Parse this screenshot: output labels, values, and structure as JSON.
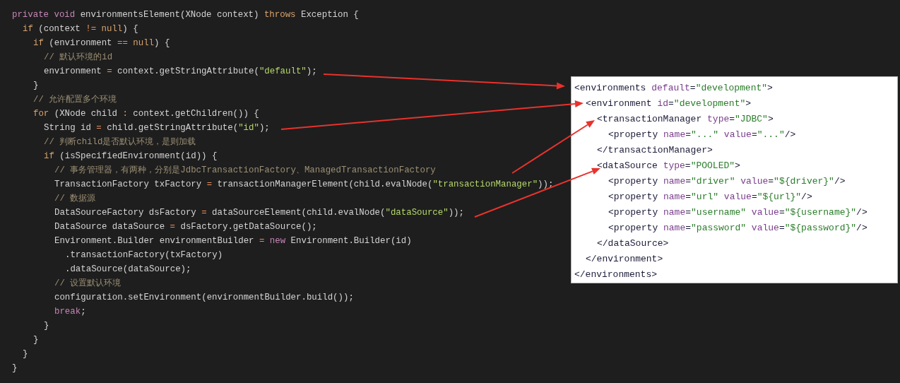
{
  "code_lines": [
    {
      "tokens": [
        {
          "t": "private void",
          "kind": "keyword"
        },
        {
          "t": " environmentsElement(XNode context) ",
          "kind": "plain"
        },
        {
          "t": "throws",
          "kind": "control"
        },
        {
          "t": " Exception {",
          "kind": "plain"
        }
      ],
      "children": [
        {
          "tokens": [
            {
              "t": "if",
              "kind": "control"
            },
            {
              "t": " (context ",
              "kind": "plain"
            },
            {
              "t": "!=",
              "kind": "op"
            },
            {
              "t": " null",
              "kind": "control"
            },
            {
              "t": ") {",
              "kind": "plain"
            }
          ],
          "children": [
            {
              "tokens": [
                {
                  "t": "if",
                  "kind": "control"
                },
                {
                  "t": " (environment ",
                  "kind": "plain"
                },
                {
                  "t": "==",
                  "kind": "op"
                },
                {
                  "t": " null",
                  "kind": "control"
                },
                {
                  "t": ") {",
                  "kind": "plain"
                }
              ],
              "children": [
                {
                  "tokens": [
                    {
                      "t": "// 默认环境的id",
                      "kind": "comment"
                    }
                  ]
                },
                {
                  "tokens": [
                    {
                      "t": "environment ",
                      "kind": "plain"
                    },
                    {
                      "t": "=",
                      "kind": "op"
                    },
                    {
                      "t": " context.getStringAttribute(",
                      "kind": "plain"
                    },
                    {
                      "t": "\"default\"",
                      "kind": "string"
                    },
                    {
                      "t": ");",
                      "kind": "plain"
                    }
                  ]
                }
              ]
            },
            {
              "tokens": [
                {
                  "t": "}",
                  "kind": "plain"
                }
              ]
            },
            {
              "tokens": [
                {
                  "t": "// 允许配置多个环境",
                  "kind": "comment"
                }
              ]
            },
            {
              "tokens": [
                {
                  "t": "for",
                  "kind": "control"
                },
                {
                  "t": " (XNode child ",
                  "kind": "plain"
                },
                {
                  "t": ":",
                  "kind": "op"
                },
                {
                  "t": " context.getChildren()) {",
                  "kind": "plain"
                }
              ],
              "children": [
                {
                  "tokens": [
                    {
                      "t": "String id ",
                      "kind": "plain"
                    },
                    {
                      "t": "=",
                      "kind": "op"
                    },
                    {
                      "t": " child.getStringAttribute(",
                      "kind": "plain"
                    },
                    {
                      "t": "\"id\"",
                      "kind": "string"
                    },
                    {
                      "t": ");",
                      "kind": "plain"
                    }
                  ]
                },
                {
                  "tokens": [
                    {
                      "t": "// 判断child是否默认环境，是则加载",
                      "kind": "comment"
                    }
                  ]
                },
                {
                  "tokens": [
                    {
                      "t": "if",
                      "kind": "control"
                    },
                    {
                      "t": " (isSpecifiedEnvironment(id)) {",
                      "kind": "plain"
                    }
                  ],
                  "children": [
                    {
                      "tokens": [
                        {
                          "t": "// 事务管理器，有两种，分别是JdbcTransactionFactory、ManagedTransactionFactory",
                          "kind": "comment"
                        }
                      ]
                    },
                    {
                      "tokens": [
                        {
                          "t": "TransactionFactory txFactory ",
                          "kind": "plain"
                        },
                        {
                          "t": "=",
                          "kind": "op"
                        },
                        {
                          "t": " transactionManagerElement(child.evalNode(",
                          "kind": "plain"
                        },
                        {
                          "t": "\"transactionManager\"",
                          "kind": "string"
                        },
                        {
                          "t": "));",
                          "kind": "plain"
                        }
                      ]
                    },
                    {
                      "tokens": [
                        {
                          "t": "// 数据源",
                          "kind": "comment"
                        }
                      ]
                    },
                    {
                      "tokens": [
                        {
                          "t": "DataSourceFactory dsFactory ",
                          "kind": "plain"
                        },
                        {
                          "t": "=",
                          "kind": "op"
                        },
                        {
                          "t": " dataSourceElement(child.evalNode(",
                          "kind": "plain"
                        },
                        {
                          "t": "\"dataSource\"",
                          "kind": "string"
                        },
                        {
                          "t": "));",
                          "kind": "plain"
                        }
                      ]
                    },
                    {
                      "tokens": [
                        {
                          "t": "DataSource dataSource ",
                          "kind": "plain"
                        },
                        {
                          "t": "=",
                          "kind": "op"
                        },
                        {
                          "t": " dsFactory.getDataSource();",
                          "kind": "plain"
                        }
                      ]
                    },
                    {
                      "tokens": [
                        {
                          "t": "Environment.Builder environmentBuilder ",
                          "kind": "plain"
                        },
                        {
                          "t": "=",
                          "kind": "op"
                        },
                        {
                          "t": " new",
                          "kind": "keyword"
                        },
                        {
                          "t": " Environment.Builder(id)",
                          "kind": "plain"
                        }
                      ],
                      "children": [
                        {
                          "tokens": [
                            {
                              "t": ".transactionFactory(txFactory)",
                              "kind": "plain"
                            }
                          ]
                        },
                        {
                          "tokens": [
                            {
                              "t": ".dataSource(dataSource);",
                              "kind": "plain"
                            }
                          ]
                        }
                      ]
                    },
                    {
                      "tokens": [
                        {
                          "t": "// 设置默认环境",
                          "kind": "comment"
                        }
                      ]
                    },
                    {
                      "tokens": [
                        {
                          "t": "configuration.setEnvironment(environmentBuilder.build());",
                          "kind": "plain"
                        }
                      ]
                    },
                    {
                      "tokens": [
                        {
                          "t": "break",
                          "kind": "keyword"
                        },
                        {
                          "t": ";",
                          "kind": "plain"
                        }
                      ]
                    }
                  ]
                },
                {
                  "tokens": [
                    {
                      "t": "}",
                      "kind": "plain"
                    }
                  ]
                }
              ]
            },
            {
              "tokens": [
                {
                  "t": "}",
                  "kind": "plain"
                }
              ]
            }
          ]
        },
        {
          "tokens": [
            {
              "t": "}",
              "kind": "plain"
            }
          ]
        }
      ]
    },
    {
      "tokens": [
        {
          "t": "}",
          "kind": "plain"
        }
      ]
    }
  ],
  "xml_lines": [
    {
      "tokens": [
        {
          "t": "<environments",
          "kind": "tag"
        },
        {
          "t": " default",
          "kind": "attr"
        },
        {
          "t": "=",
          "kind": "tag"
        },
        {
          "t": "\"development\"",
          "kind": "value"
        },
        {
          "t": ">",
          "kind": "tag"
        }
      ],
      "children": [
        {
          "tokens": [
            {
              "t": "<environment",
              "kind": "tag"
            },
            {
              "t": " id",
              "kind": "attr"
            },
            {
              "t": "=",
              "kind": "tag"
            },
            {
              "t": "\"development\"",
              "kind": "value"
            },
            {
              "t": ">",
              "kind": "tag"
            }
          ],
          "children": [
            {
              "tokens": [
                {
                  "t": "<transactionManager",
                  "kind": "tag"
                },
                {
                  "t": " type",
                  "kind": "attr"
                },
                {
                  "t": "=",
                  "kind": "tag"
                },
                {
                  "t": "\"JDBC\"",
                  "kind": "value"
                },
                {
                  "t": ">",
                  "kind": "tag"
                }
              ],
              "children": [
                {
                  "tokens": [
                    {
                      "t": "<property",
                      "kind": "tag"
                    },
                    {
                      "t": " name",
                      "kind": "attr"
                    },
                    {
                      "t": "=",
                      "kind": "tag"
                    },
                    {
                      "t": "\"...\"",
                      "kind": "value"
                    },
                    {
                      "t": " value",
                      "kind": "attr"
                    },
                    {
                      "t": "=",
                      "kind": "tag"
                    },
                    {
                      "t": "\"...\"",
                      "kind": "value"
                    },
                    {
                      "t": "/>",
                      "kind": "tag"
                    }
                  ]
                }
              ]
            },
            {
              "tokens": [
                {
                  "t": "</transactionManager>",
                  "kind": "tag"
                }
              ]
            },
            {
              "tokens": [
                {
                  "t": "<dataSource",
                  "kind": "tag"
                },
                {
                  "t": " type",
                  "kind": "attr"
                },
                {
                  "t": "=",
                  "kind": "tag"
                },
                {
                  "t": "\"POOLED\"",
                  "kind": "value"
                },
                {
                  "t": ">",
                  "kind": "tag"
                }
              ],
              "children": [
                {
                  "tokens": [
                    {
                      "t": "<property",
                      "kind": "tag"
                    },
                    {
                      "t": " name",
                      "kind": "attr"
                    },
                    {
                      "t": "=",
                      "kind": "tag"
                    },
                    {
                      "t": "\"driver\"",
                      "kind": "value"
                    },
                    {
                      "t": " value",
                      "kind": "attr"
                    },
                    {
                      "t": "=",
                      "kind": "tag"
                    },
                    {
                      "t": "\"${driver}\"",
                      "kind": "value"
                    },
                    {
                      "t": "/>",
                      "kind": "tag"
                    }
                  ]
                },
                {
                  "tokens": [
                    {
                      "t": "<property",
                      "kind": "tag"
                    },
                    {
                      "t": " name",
                      "kind": "attr"
                    },
                    {
                      "t": "=",
                      "kind": "tag"
                    },
                    {
                      "t": "\"url\"",
                      "kind": "value"
                    },
                    {
                      "t": " value",
                      "kind": "attr"
                    },
                    {
                      "t": "=",
                      "kind": "tag"
                    },
                    {
                      "t": "\"${url}\"",
                      "kind": "value"
                    },
                    {
                      "t": "/>",
                      "kind": "tag"
                    }
                  ]
                },
                {
                  "tokens": [
                    {
                      "t": "<property",
                      "kind": "tag"
                    },
                    {
                      "t": " name",
                      "kind": "attr"
                    },
                    {
                      "t": "=",
                      "kind": "tag"
                    },
                    {
                      "t": "\"username\"",
                      "kind": "value"
                    },
                    {
                      "t": " value",
                      "kind": "attr"
                    },
                    {
                      "t": "=",
                      "kind": "tag"
                    },
                    {
                      "t": "\"${username}\"",
                      "kind": "value"
                    },
                    {
                      "t": "/>",
                      "kind": "tag"
                    }
                  ]
                },
                {
                  "tokens": [
                    {
                      "t": "<property",
                      "kind": "tag"
                    },
                    {
                      "t": " name",
                      "kind": "attr"
                    },
                    {
                      "t": "=",
                      "kind": "tag"
                    },
                    {
                      "t": "\"password\"",
                      "kind": "value"
                    },
                    {
                      "t": " value",
                      "kind": "attr"
                    },
                    {
                      "t": "=",
                      "kind": "tag"
                    },
                    {
                      "t": "\"${password}\"",
                      "kind": "value"
                    },
                    {
                      "t": "/>",
                      "kind": "tag"
                    }
                  ]
                }
              ]
            },
            {
              "tokens": [
                {
                  "t": "</dataSource>",
                  "kind": "tag"
                }
              ]
            }
          ]
        },
        {
          "tokens": [
            {
              "t": "</environment>",
              "kind": "tag"
            }
          ]
        }
      ]
    },
    {
      "tokens": [
        {
          "t": "</environments>",
          "kind": "tag"
        }
      ]
    }
  ]
}
